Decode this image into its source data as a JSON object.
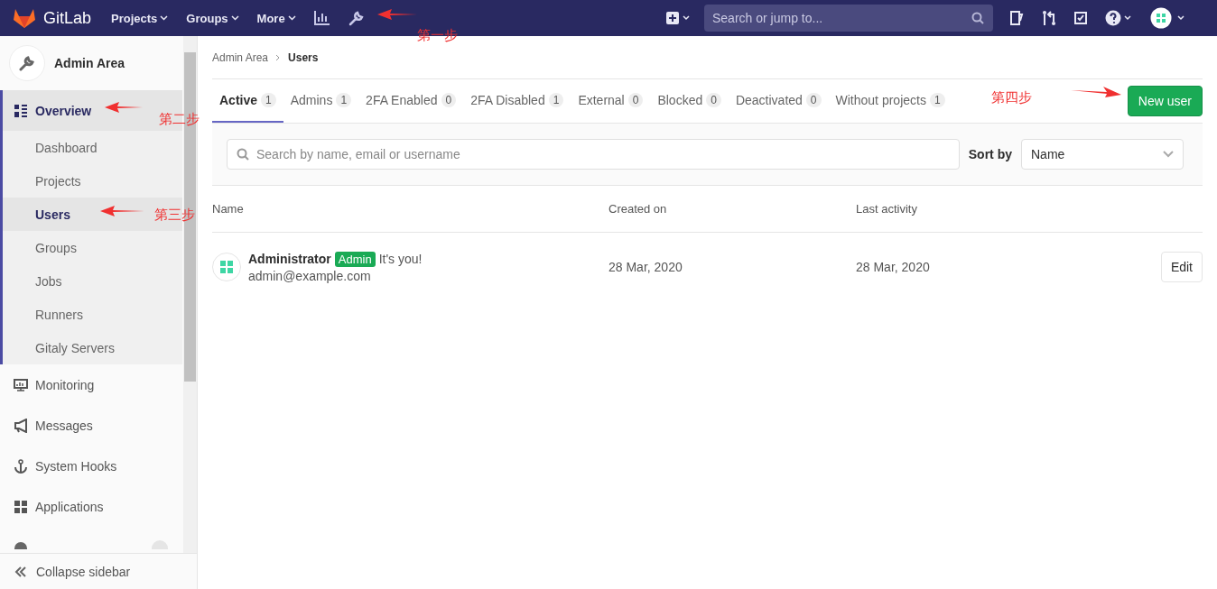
{
  "top_nav": {
    "brand": "GitLab",
    "menus": [
      {
        "label": "Projects"
      },
      {
        "label": "Groups"
      },
      {
        "label": "More"
      }
    ],
    "search": {
      "placeholder": "Search or jump to..."
    }
  },
  "sidebar": {
    "title": "Admin Area",
    "items": [
      {
        "label": "Overview",
        "kind": "overview",
        "selected": true,
        "expanded": true,
        "children": [
          {
            "label": "Dashboard",
            "selected": false
          },
          {
            "label": "Projects",
            "selected": false
          },
          {
            "label": "Users",
            "selected": true
          },
          {
            "label": "Groups",
            "selected": false
          },
          {
            "label": "Jobs",
            "selected": false
          },
          {
            "label": "Runners",
            "selected": false
          },
          {
            "label": "Gitaly Servers",
            "selected": false
          }
        ]
      },
      {
        "label": "Monitoring",
        "kind": "monitoring",
        "selected": false,
        "expanded": false
      },
      {
        "label": "Messages",
        "kind": "messages",
        "selected": false,
        "expanded": false
      },
      {
        "label": "System Hooks",
        "kind": "hooks",
        "selected": false,
        "expanded": false
      },
      {
        "label": "Applications",
        "kind": "applications",
        "selected": false,
        "expanded": false
      }
    ],
    "collapse_label": "Collapse sidebar"
  },
  "breadcrumb": [
    "Admin Area",
    "Users"
  ],
  "tabs": [
    {
      "label": "Active",
      "count": "1",
      "selected": true
    },
    {
      "label": "Admins",
      "count": "1",
      "selected": false
    },
    {
      "label": "2FA Enabled",
      "count": "0",
      "selected": false
    },
    {
      "label": "2FA Disabled",
      "count": "1",
      "selected": false
    },
    {
      "label": "External",
      "count": "0",
      "selected": false
    },
    {
      "label": "Blocked",
      "count": "0",
      "selected": false
    },
    {
      "label": "Deactivated",
      "count": "0",
      "selected": false
    },
    {
      "label": "Without projects",
      "count": "1",
      "selected": false
    }
  ],
  "new_user_button": "New user",
  "filter": {
    "placeholder": "Search by name, email or username",
    "sort_label": "Sort by",
    "sort_value": "Name"
  },
  "table": {
    "columns": [
      "Name",
      "Created on",
      "Last activity"
    ],
    "rows": [
      {
        "name": "Administrator",
        "badge": "Admin",
        "note": "It's you!",
        "email": "admin@example.com",
        "created": "28 Mar, 2020",
        "last_activity": "28 Mar, 2020",
        "action": "Edit"
      }
    ]
  },
  "annotations": [
    {
      "text": "第一步"
    },
    {
      "text": "第二步"
    },
    {
      "text": "第三步"
    },
    {
      "text": "第四步"
    }
  ]
}
